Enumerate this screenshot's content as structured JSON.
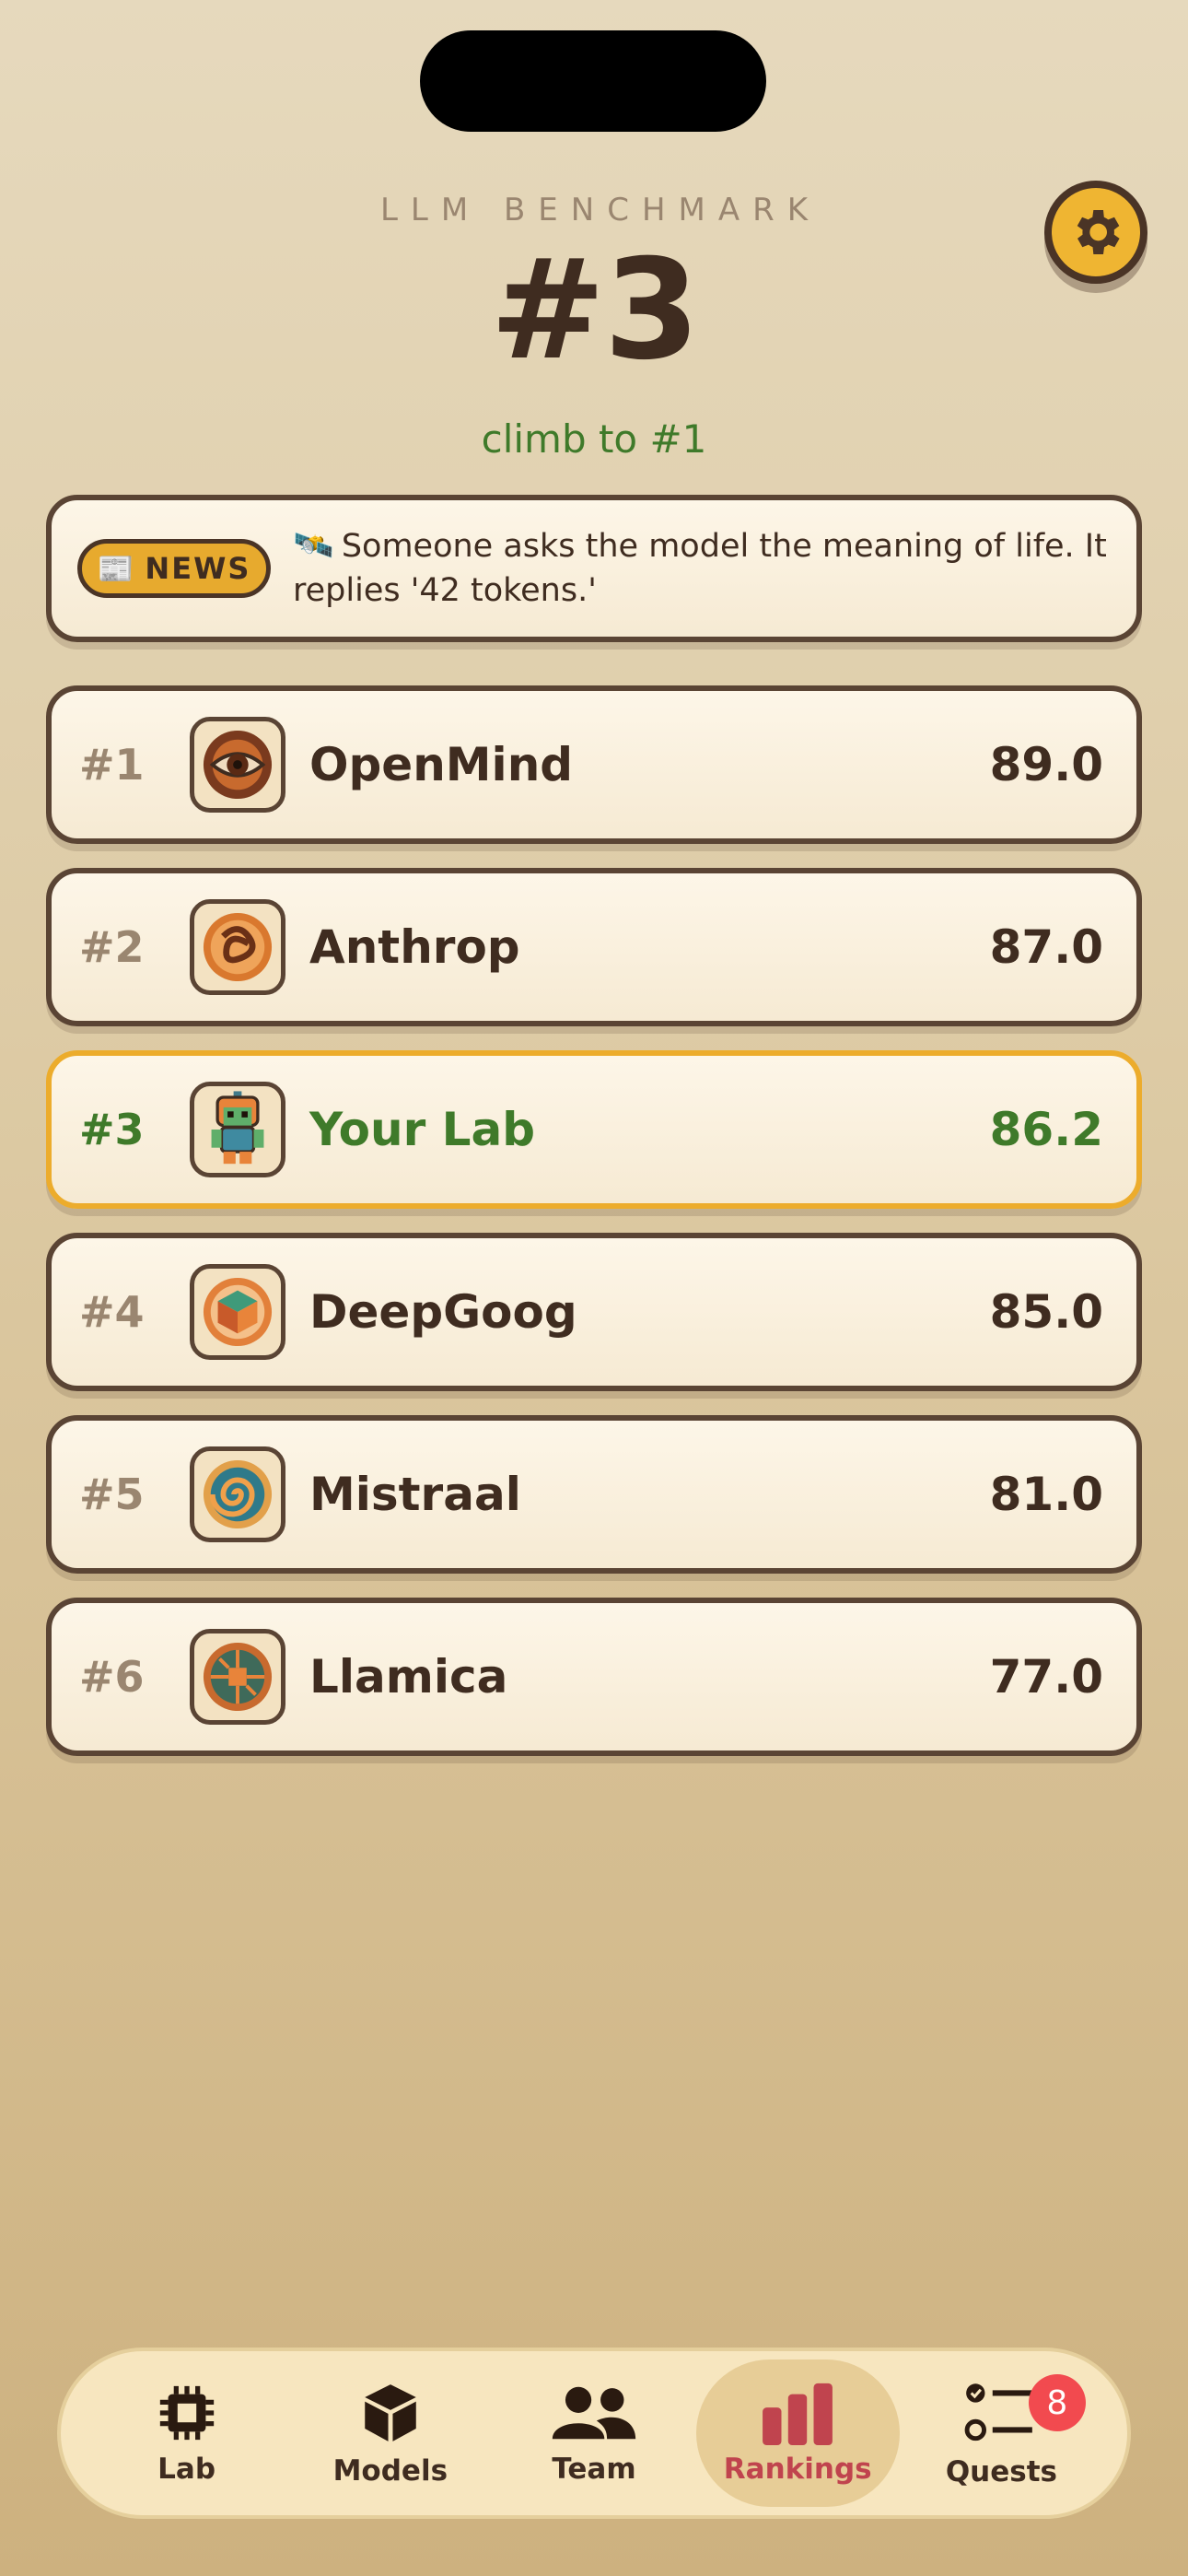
{
  "header": {
    "eyebrow": "LLM BENCHMARK",
    "rank": "#3",
    "subtitle": "climb to #1"
  },
  "settings": {
    "icon": "gear-icon"
  },
  "news": {
    "pill_icon": "📰",
    "pill_label": "NEWS",
    "emoji": "🛰️",
    "text": "Someone asks the model the meaning of life. It replies '42 tokens.'"
  },
  "leaderboard": [
    {
      "rank": "#1",
      "name": "OpenMind",
      "score": "89.0",
      "avatar": "eye-avatar"
    },
    {
      "rank": "#2",
      "name": "Anthrop",
      "score": "87.0",
      "avatar": "knot-avatar"
    },
    {
      "rank": "#3",
      "name": "Your Lab",
      "score": "86.2",
      "avatar": "robot-avatar",
      "is_player": true
    },
    {
      "rank": "#4",
      "name": "DeepGoog",
      "score": "85.0",
      "avatar": "cube-avatar"
    },
    {
      "rank": "#5",
      "name": "Mistraal",
      "score": "81.0",
      "avatar": "swirl-avatar"
    },
    {
      "rank": "#6",
      "name": "Llamica",
      "score": "77.0",
      "avatar": "circuit-avatar"
    }
  ],
  "tabs": [
    {
      "label": "Lab",
      "icon": "chip-icon"
    },
    {
      "label": "Models",
      "icon": "box-icon"
    },
    {
      "label": "Team",
      "icon": "people-icon"
    },
    {
      "label": "Rankings",
      "icon": "bar-chart-icon",
      "active": true
    },
    {
      "label": "Quests",
      "icon": "checklist-icon",
      "badge": "8"
    }
  ],
  "colors": {
    "accent_green": "#3f7a2a",
    "gold": "#ecac2c",
    "active_tab": "#c0444e",
    "badge_red": "#f24a4f",
    "ink": "#3f2c20"
  }
}
